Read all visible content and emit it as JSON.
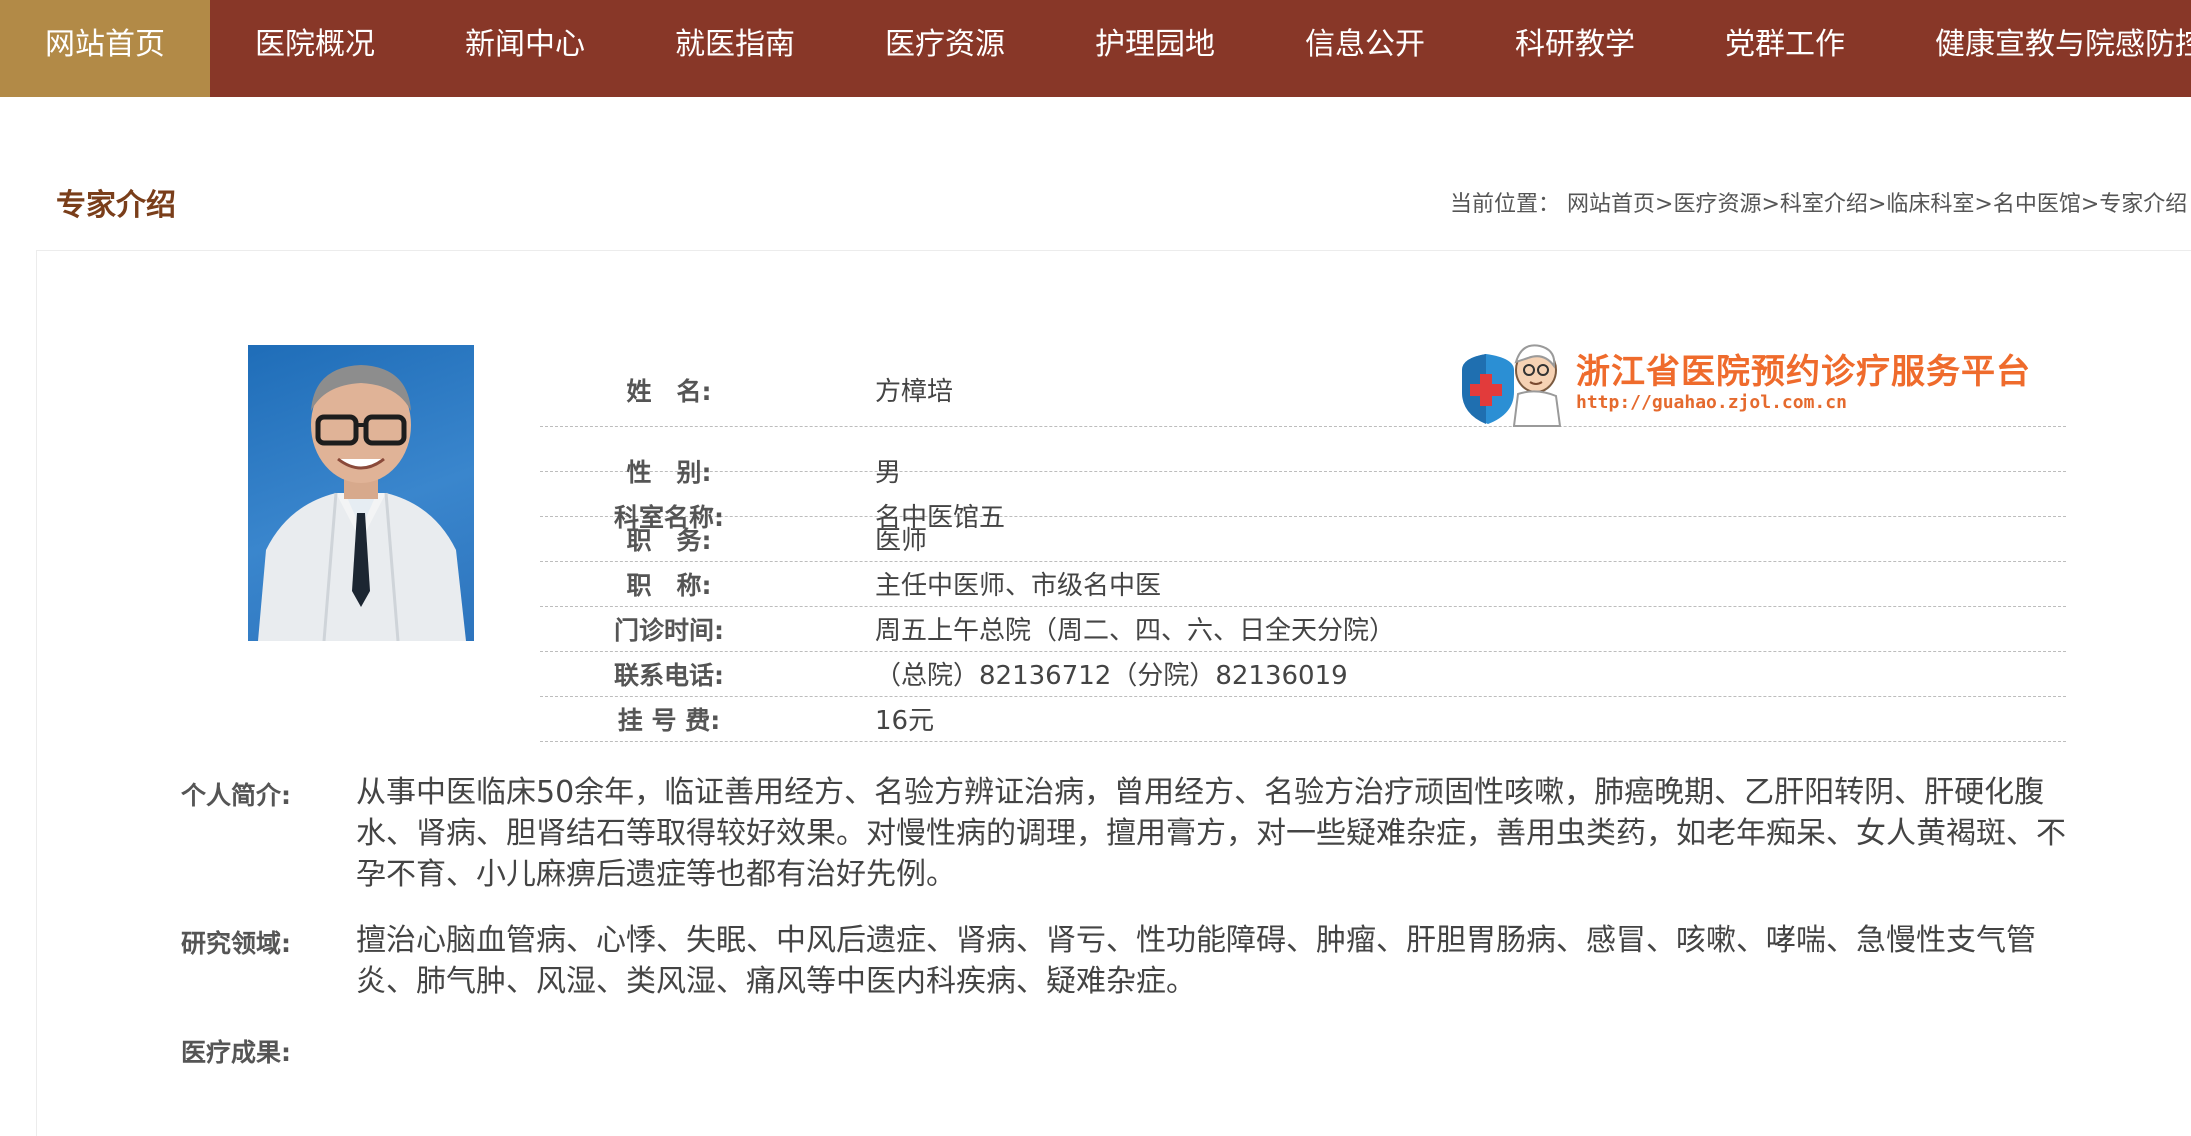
{
  "nav": {
    "items": [
      "网站首页",
      "医院概况",
      "新闻中心",
      "就医指南",
      "医疗资源",
      "护理园地",
      "信息公开",
      "科研教学",
      "党群工作",
      "健康宣教与院感防控"
    ],
    "active_index": 0
  },
  "page_title": "专家介绍",
  "breadcrumb": {
    "prefix": "当前位置：",
    "items": [
      "网站首页",
      "医疗资源",
      "科室介绍",
      "临床科室",
      "名中医馆",
      "专家介绍"
    ],
    "separator": ">"
  },
  "booking_logo": {
    "title": "浙江省医院预约诊疗服务平台",
    "url": "http://guahao.zjol.com.cn"
  },
  "doctor": {
    "rows": [
      {
        "label": "姓　名:",
        "value": "方樟培"
      },
      {
        "label": "性　别:",
        "value": "男"
      },
      {
        "label": "科室名称:",
        "value": "名中医馆五"
      },
      {
        "label": "职　务:",
        "value": "医师"
      },
      {
        "label": "职　称:",
        "value": "主任中医师、市级名中医"
      },
      {
        "label": "门诊时间:",
        "value": "周五上午总院（周二、四、六、日全天分院）"
      },
      {
        "label": "联系电话:",
        "value": "（总院）82136712（分院）82136019"
      },
      {
        "label": "挂 号 费:",
        "value": "16元"
      }
    ],
    "intro_label": "个人简介:",
    "intro": " 从事中医临床50余年，临证善用经方、名验方辨证治病，曾用经方、名验方治疗顽固性咳嗽，肺癌晚期、乙肝阳转阴、肝硬化腹水、肾病、胆肾结石等取得较好效果。对慢性病的调理，擅用膏方，对一些疑难杂症，善用虫类药，如老年痴呆、女人黄褐斑、不孕不育、小儿麻痹后遗症等也都有治好先例。",
    "research_label": "研究领域:",
    "research": "擅治心脑血管病、心悸、失眠、中风后遗症、肾病、肾亏、性功能障碍、肿瘤、肝胆胃肠病、感冒、咳嗽、哮喘、急慢性支气管炎、肺气肿、风湿、类风湿、痛风等中医内科疾病、疑难杂症。",
    "achievements_label": "医疗成果:",
    "achievements": ""
  },
  "colors": {
    "nav_bg": "#883728",
    "nav_active_bg": "#b28a47",
    "title": "#7a3e1a",
    "logo_orange": "#ef6b2c"
  }
}
